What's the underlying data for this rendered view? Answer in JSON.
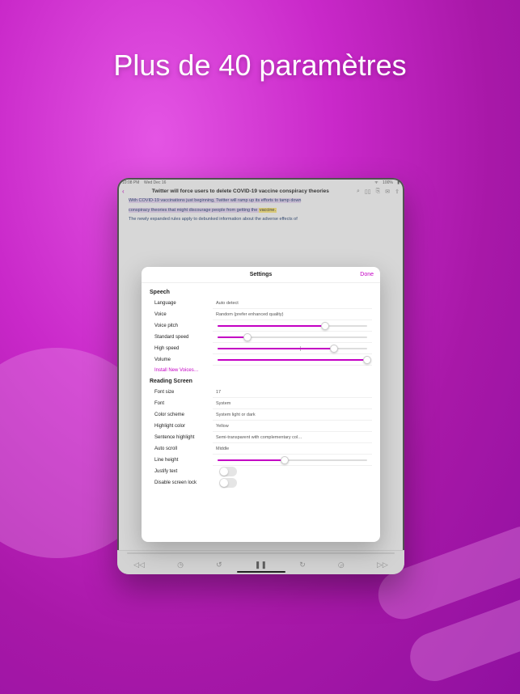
{
  "headline": "Plus de 40 paramètres",
  "status": {
    "time": "10:08 PM",
    "date": "Wed Dec 16",
    "wifi": "􀙇",
    "battery_pct": "100%"
  },
  "nav": {
    "title": "Twitter will force users to delete COVID-19 vaccine conspiracy theories",
    "icons": {
      "search": "search-icon",
      "book": "book-icon",
      "bookmark": "bookmark-icon",
      "chat": "chat-icon",
      "share": "share-icon"
    }
  },
  "article": {
    "p1a": "With COVID-19 vaccinations just beginning, Twitter will ramp up its efforts to tamp down",
    "p1b": "conspiracy theories that might discourage people from getting the ",
    "p1_hl": "vaccine.",
    "p2": "The newly expanded rules apply to debunked information about the adverse effects of"
  },
  "modal": {
    "title": "Settings",
    "done": "Done",
    "sections": {
      "speech": {
        "title": "Speech",
        "language": {
          "label": "Language",
          "value": "Auto detect"
        },
        "voice": {
          "label": "Voice",
          "value": "Random (prefer enhanced quality)"
        },
        "voice_pitch": {
          "label": "Voice pitch",
          "pct": 72
        },
        "standard_speed": {
          "label": "Standard speed",
          "pct": 20
        },
        "high_speed": {
          "label": "High speed",
          "pct": 78,
          "tick_pct": 55
        },
        "volume": {
          "label": "Volume",
          "pct": 100
        },
        "install": "Install New Voices…"
      },
      "reading": {
        "title": "Reading Screen",
        "font_size": {
          "label": "Font size",
          "value": "17"
        },
        "font": {
          "label": "Font",
          "value": "System"
        },
        "color_scheme": {
          "label": "Color scheme",
          "value": "System light or dark"
        },
        "highlight_color": {
          "label": "Highlight color",
          "value": "Yellow"
        },
        "sentence_highlight": {
          "label": "Sentence highlight",
          "value": "Semi-transparent with complementary col…"
        },
        "auto_scroll": {
          "label": "Auto scroll",
          "value": "Middle"
        },
        "line_height": {
          "label": "Line height",
          "pct": 45
        },
        "justify": {
          "label": "Justify text"
        },
        "screenlock": {
          "label": "Disable screen lock"
        }
      }
    }
  },
  "player": {
    "elapsed": "",
    "remaining": ""
  }
}
